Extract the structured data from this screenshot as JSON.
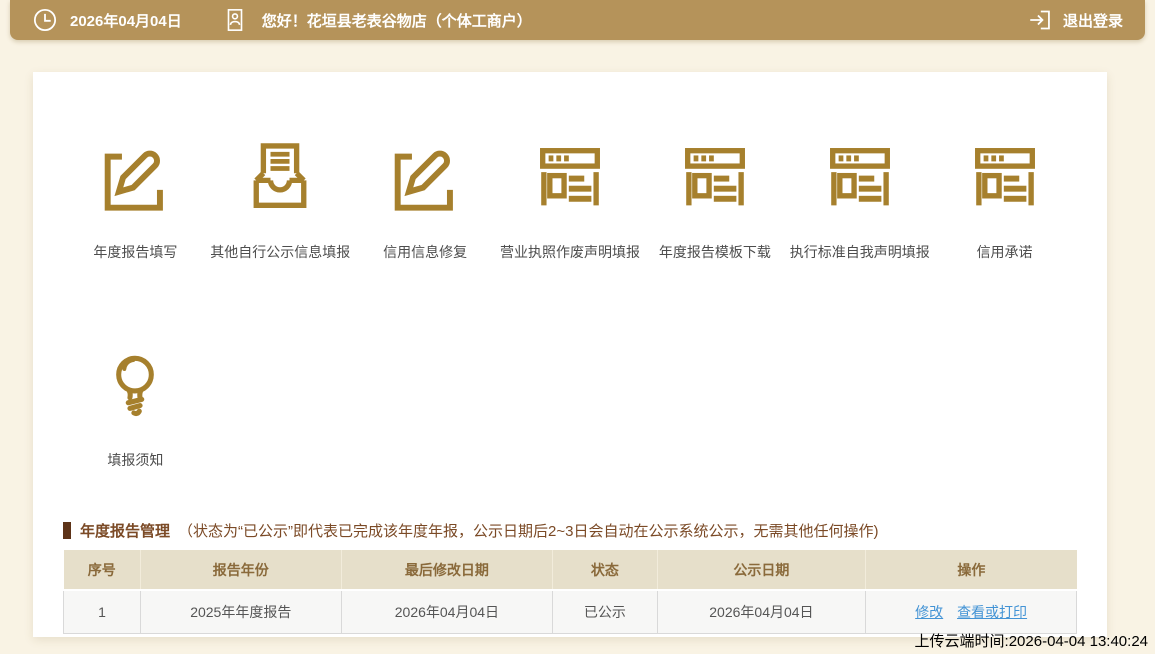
{
  "topbar": {
    "date": "2026年04月04日",
    "greeting": "您好！花垣县老表谷物店（个体工商户）",
    "logout_label": "退出登录",
    "icons": [
      "clock-icon",
      "id-badge-icon",
      "logout-icon"
    ]
  },
  "shortcuts": [
    {
      "label": "年度报告填写",
      "icon": "edit-icon"
    },
    {
      "label": "其他自行公示信息填报",
      "icon": "inbox-document-icon"
    },
    {
      "label": "信用信息修复",
      "icon": "edit-icon"
    },
    {
      "label": "营业执照作废声明填报",
      "icon": "browser-window-icon"
    },
    {
      "label": "年度报告模板下载",
      "icon": "browser-window-icon"
    },
    {
      "label": "执行标准自我声明填报",
      "icon": "browser-window-icon"
    },
    {
      "label": "信用承诺",
      "icon": "browser-window-icon"
    }
  ],
  "notice": {
    "label": "填报须知",
    "icon": "lightbulb-icon"
  },
  "section": {
    "title": "年度报告管理",
    "note": "（状态为“已公示”即代表已完成该年度年报，公示日期后2~3日会自动在公示系统公示，无需其他任何操作)"
  },
  "table": {
    "headers": [
      "序号",
      "报告年份",
      "最后修改日期",
      "状态",
      "公示日期",
      "操作"
    ],
    "rows": [
      {
        "index": "1",
        "year": "2025年年度报告",
        "modified": "2026年04月04日",
        "status": "已公示",
        "publish_date": "2026年04月04日",
        "actions": [
          "修改",
          "查看或打印"
        ]
      }
    ]
  },
  "footer": {
    "upload_time": "上传云端时间:2026-04-04 13:40:24"
  },
  "colors": {
    "topbar_bg": "#b5935a",
    "page_bg": "#f9f3e4",
    "icon_accent": "#a6802d",
    "section_text": "#7b4a26",
    "section_marker": "#5d3318",
    "table_header_bg": "#e6dfca",
    "table_header_text": "#8a6a3b",
    "link": "#4293d5"
  }
}
